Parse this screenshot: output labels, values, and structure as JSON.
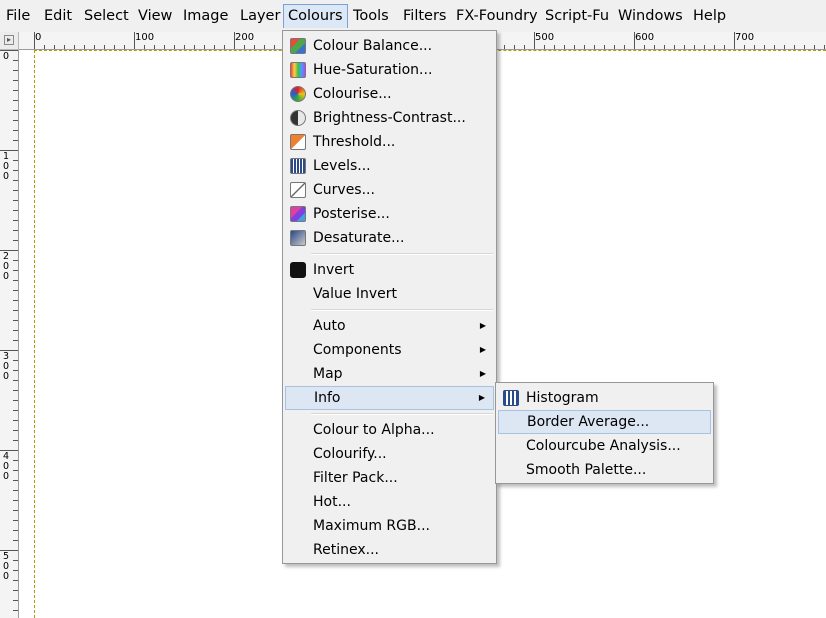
{
  "menubar": {
    "items": [
      "File",
      "Edit",
      "Select",
      "View",
      "Image",
      "Layer",
      "Colours",
      "Tools",
      "Filters",
      "FX-Foundry",
      "Script-Fu",
      "Windows",
      "Help"
    ],
    "open_item": "Colours"
  },
  "rulers": {
    "horizontal_labels": [
      "0",
      "100",
      "200",
      "500",
      "600",
      "700"
    ],
    "vertical_labels": [
      "0",
      "1\n0\n0",
      "2\n0\n0",
      "3\n0\n0",
      "4\n0\n0",
      "5\n0\n0"
    ]
  },
  "colours_menu": {
    "items": [
      {
        "label": "Colour Balance...",
        "icon": "colour-balance-icon"
      },
      {
        "label": "Hue-Saturation...",
        "icon": "hue-saturation-icon"
      },
      {
        "label": "Colourise...",
        "icon": "colourise-icon"
      },
      {
        "label": "Brightness-Contrast...",
        "icon": "brightness-contrast-icon"
      },
      {
        "label": "Threshold...",
        "icon": "threshold-icon"
      },
      {
        "label": "Levels...",
        "icon": "levels-icon"
      },
      {
        "label": "Curves...",
        "icon": "curves-icon"
      },
      {
        "label": "Posterise...",
        "icon": "posterise-icon"
      },
      {
        "label": "Desaturate...",
        "icon": "desaturate-icon"
      },
      {
        "label": "Invert",
        "icon": "invert-icon"
      },
      {
        "label": "Value Invert"
      },
      {
        "label": "Auto",
        "submenu": true
      },
      {
        "label": "Components",
        "submenu": true
      },
      {
        "label": "Map",
        "submenu": true
      },
      {
        "label": "Info",
        "submenu": true,
        "highlighted": true
      },
      {
        "label": "Colour to Alpha..."
      },
      {
        "label": "Colourify..."
      },
      {
        "label": "Filter Pack..."
      },
      {
        "label": "Hot..."
      },
      {
        "label": "Maximum RGB..."
      },
      {
        "label": "Retinex..."
      }
    ]
  },
  "info_submenu": {
    "items": [
      {
        "label": "Histogram",
        "icon": "histogram-icon"
      },
      {
        "label": "Border Average...",
        "highlighted": true
      },
      {
        "label": "Colourcube Analysis..."
      },
      {
        "label": "Smooth Palette..."
      }
    ]
  },
  "colors": {
    "menu_bg": "#f0f0f0",
    "highlight_bg": "#dde7f4",
    "highlight_border": "#a9c2e4",
    "guide": "#b89a00"
  }
}
